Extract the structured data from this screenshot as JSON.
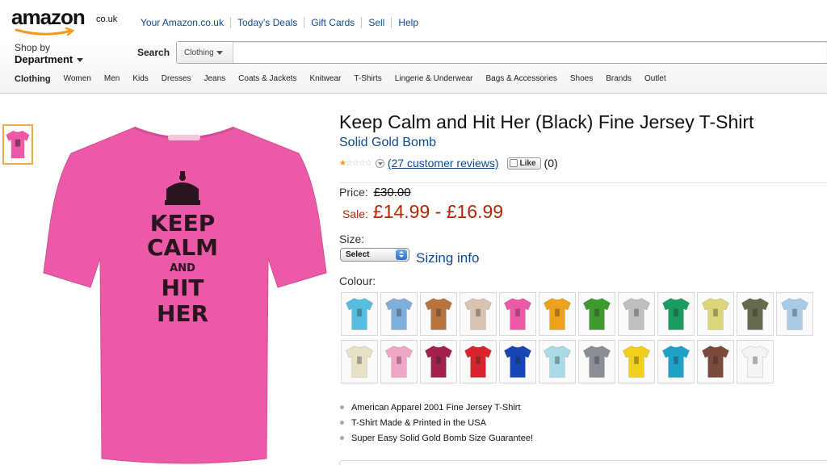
{
  "header": {
    "logo": "amazon",
    "logo_tld": "co.uk",
    "top_links": [
      "Your Amazon.co.uk",
      "Today's Deals",
      "Gift Cards",
      "Sell",
      "Help"
    ],
    "shop_by_small": "Shop by",
    "shop_by_big": "Department",
    "search_label": "Search",
    "search_category": "Clothing",
    "search_value": ""
  },
  "category_nav": [
    "Clothing",
    "Women",
    "Men",
    "Kids",
    "Dresses",
    "Jeans",
    "Coats & Jackets",
    "Knitwear",
    "T-Shirts",
    "Lingerie & Underwear",
    "Bags & Accessories",
    "Shoes",
    "Brands",
    "Outlet"
  ],
  "product": {
    "title": "Keep Calm and Hit Her (Black) Fine Jersey T-Shirt",
    "brand": "Solid Gold Bomb",
    "stars": 0.5,
    "reviews_link": "(27 customer reviews)",
    "like_label": "Like",
    "like_count": "(0)",
    "price_label": "Price:",
    "price_old": "£30.00",
    "sale_label": "Sale:",
    "sale_price": "£14.99 - £16.99",
    "size_label": "Size:",
    "size_selected": "Select",
    "sizing_info": "Sizing info",
    "colour_label": "Colour:",
    "shirt_text": [
      "KEEP",
      "CALM",
      "AND",
      "HIT",
      "HER"
    ],
    "main_colour": "#ec5aa7",
    "colours_row1": [
      "#56bde0",
      "#7fb0dc",
      "#b7743f",
      "#d8c2b0",
      "#ec5aa7",
      "#eea21c",
      "#3e9a2d",
      "#bfbfbf",
      "#1a9b5f",
      "#dad679",
      "#676a4f",
      "#a9cbe7"
    ],
    "colours_row2": [
      "#e9e1c5",
      "#f1a6c7",
      "#a3204f",
      "#d8242f",
      "#1647b5",
      "#a8dbe6",
      "#8a8f95",
      "#f0cf1d",
      "#1fa1c8",
      "#7a4b3b",
      "#f4f4f4"
    ],
    "bullets": [
      "American Apparel 2001 Fine Jersey T-Shirt",
      "T-Shirt Made & Printed in the USA",
      "Super Easy Solid Gold Bomb Size Guarantee!"
    ]
  }
}
